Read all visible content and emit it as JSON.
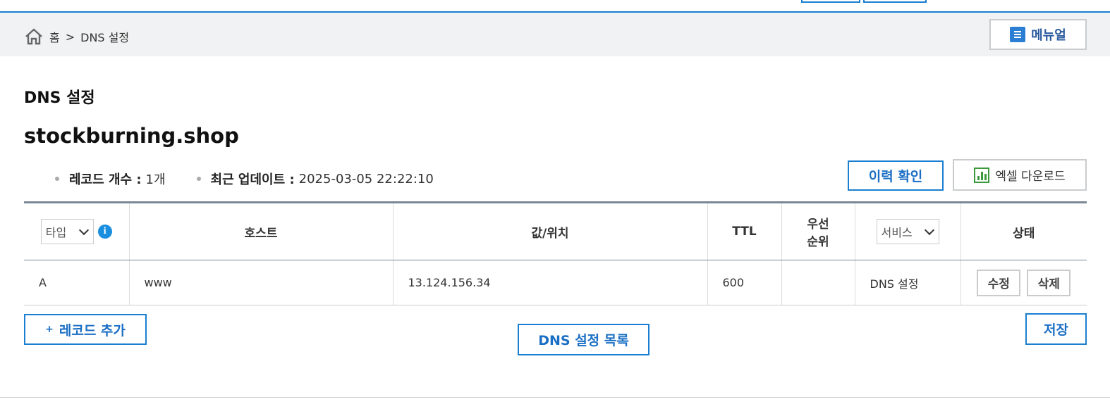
{
  "breadcrumb": {
    "home": "홈",
    "separator": ">",
    "current": "DNS 설정"
  },
  "manual_button": "메뉴얼",
  "page_title": "DNS 설정",
  "domain": "stockburning.shop",
  "meta": {
    "record_count_label": "레코드 개수 :",
    "record_count_value": "1개",
    "updated_label": "최근 업데이트 :",
    "updated_value": "2025-03-05 22:22:10"
  },
  "buttons": {
    "history": "이력 확인",
    "excel": "엑셀 다운로드",
    "add_record": "레코드 추가",
    "add_plus": "+",
    "dns_list": "DNS 설정 목록",
    "save": "저장"
  },
  "table": {
    "headers": {
      "type_select": "타입",
      "info": "i",
      "host": "호스트",
      "value": "값/위치",
      "ttl": "TTL",
      "priority_line1": "우선",
      "priority_line2": "순위",
      "service_select": "서비스",
      "status": "상태"
    },
    "rows": [
      {
        "type": "A",
        "host": "www",
        "value": "13.124.156.34",
        "ttl": "600",
        "priority": "",
        "service": "DNS 설정",
        "edit": "수정",
        "delete": "삭제"
      }
    ]
  },
  "colors": {
    "accent": "#1a7fd1",
    "excel_green": "#3c9a3c",
    "breadcrumb_bg": "#f1f2f3"
  },
  "icons": [
    "home-icon",
    "manual-list-icon",
    "excel-chart-icon",
    "info-icon",
    "chevron-down-icon"
  ]
}
